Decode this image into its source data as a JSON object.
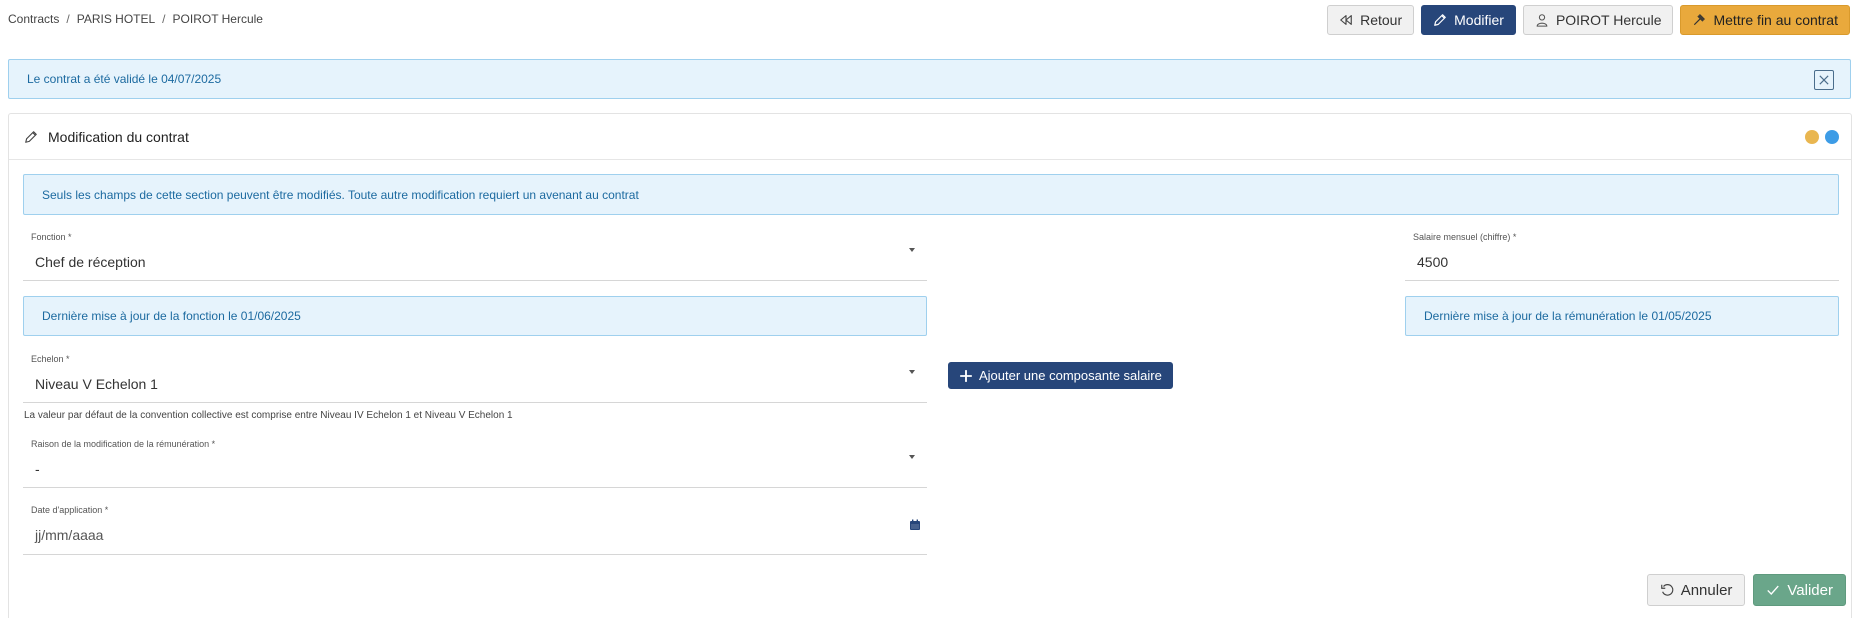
{
  "breadcrumb": [
    "Contracts",
    "PARIS HOTEL",
    "POIROT Hercule"
  ],
  "toolbar": {
    "back_label": "Retour",
    "edit_label": "Modifier",
    "employee_label": "POIROT Hercule",
    "end_contract_label": "Mettre fin au contrat"
  },
  "alert_validated": "Le contrat a été validé le 04/07/2025",
  "card": {
    "title": "Modification du contrat",
    "status_colors": [
      "#e9b650",
      "#3d9ce6"
    ],
    "section_info": "Seuls les champs de cette section peuvent être modifiés. Toute autre modification requiert un avenant au contrat"
  },
  "fonction": {
    "label": "Fonction *",
    "value": "Chef de réception",
    "info": "Dernière mise à jour de la fonction le 01/06/2025"
  },
  "salaire": {
    "label": "Salaire mensuel (chiffre) *",
    "value": "4500",
    "info": "Dernière mise à jour de la rémunération le 01/05/2025"
  },
  "echelon": {
    "label": "Echelon *",
    "value": "Niveau V Echelon 1",
    "hint": "La valeur par défaut de la convention collective est comprise entre Niveau IV Echelon 1 et Niveau V Echelon 1"
  },
  "add_component_label": "Ajouter une composante salaire",
  "raison": {
    "label": "Raison de la modification de la rémunération *",
    "value": "-"
  },
  "date_application": {
    "label": "Date d'application *",
    "placeholder": "jj/mm/aaaa"
  },
  "footer": {
    "cancel_label": "Annuler",
    "validate_label": "Valider"
  }
}
